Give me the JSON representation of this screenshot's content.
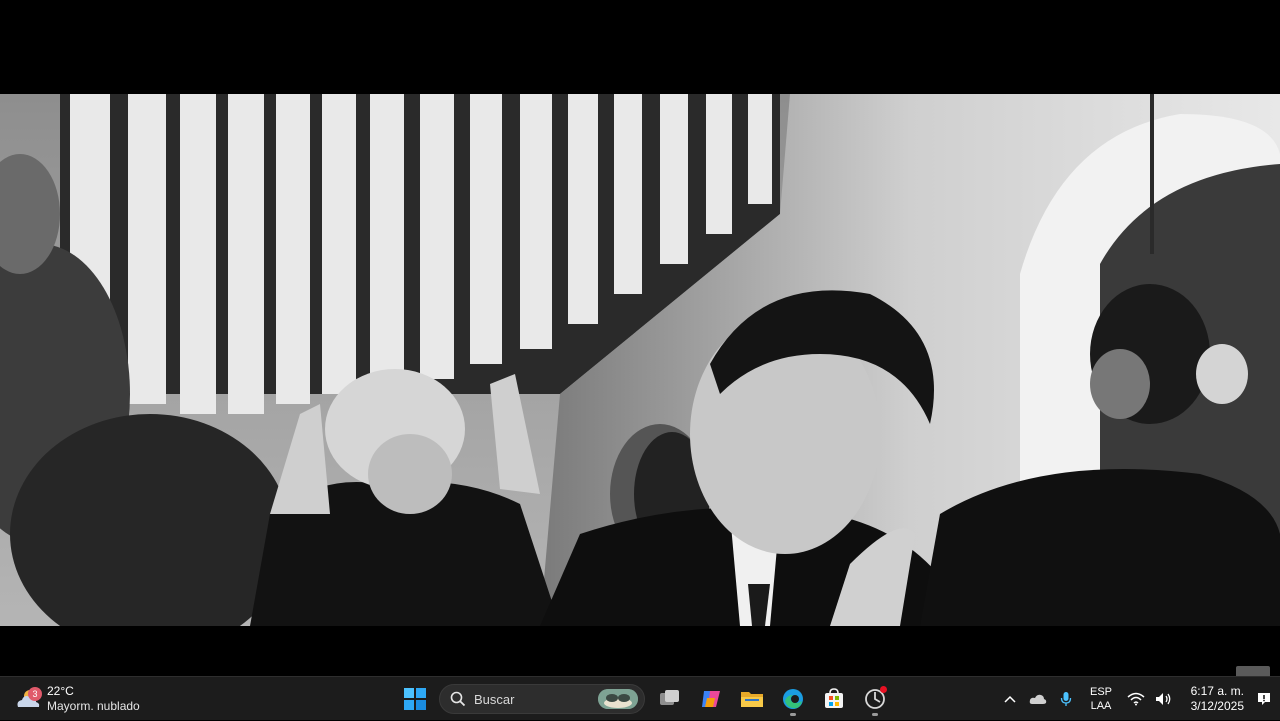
{
  "video": {
    "description_visible": false
  },
  "taskbar": {
    "weather": {
      "badge": "3",
      "temperature": "22°C",
      "condition": "Mayorm. nublado"
    },
    "search": {
      "placeholder": "Buscar"
    },
    "pinned": [
      {
        "name": "start",
        "icon": "windows-start-icon"
      },
      {
        "name": "task-view",
        "icon": "task-view-icon"
      },
      {
        "name": "copilot",
        "icon": "copilot-icon"
      },
      {
        "name": "file-explorer",
        "icon": "folder-icon"
      },
      {
        "name": "edge",
        "icon": "edge-icon"
      },
      {
        "name": "store",
        "icon": "store-icon"
      },
      {
        "name": "app",
        "icon": "app-icon"
      }
    ],
    "tray": {
      "language_top": "ESP",
      "language_bottom": "LAA",
      "time": "6:17 a. m.",
      "date": "3/12/2025"
    },
    "colors": {
      "taskbar_bg": "#1c1c1c",
      "accent_blue": "#0078d4",
      "notification_red": "#e81123"
    }
  }
}
